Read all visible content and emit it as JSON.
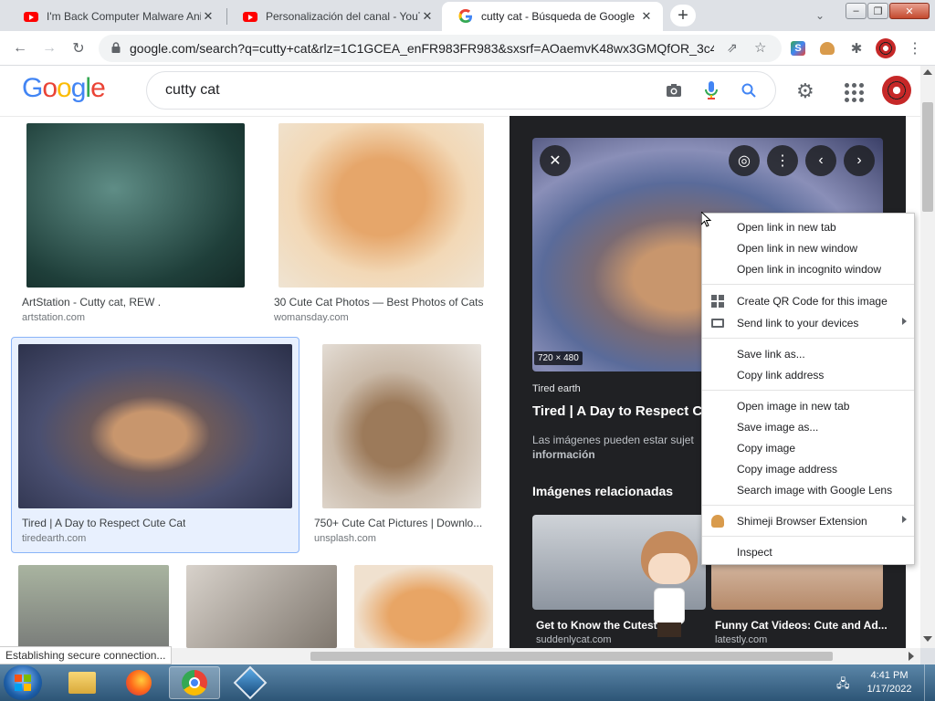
{
  "browser": {
    "tabs": [
      {
        "title": "I'm Back Computer Malware Anim",
        "favicon": "youtube-icon"
      },
      {
        "title": "Personalización del canal - YouTu",
        "favicon": "youtube-icon"
      },
      {
        "title": "cutty cat - Búsqueda de Google",
        "favicon": "google-icon",
        "active": true
      }
    ],
    "url": "google.com/search?q=cutty+cat&rlz=1C1GCEA_enFR983FR983&sxsrf=AOaemvK48wx3GMQfOR_3c4..."
  },
  "google": {
    "logo": "Google",
    "query": "cutty cat"
  },
  "results": [
    {
      "title": "ArtStation - Cutty cat, REW .",
      "site": "artstation.com"
    },
    {
      "title": "30 Cute Cat Photos — Best Photos of Cats",
      "site": "womansday.com"
    },
    {
      "title": "Tired | A Day to Respect Cute Cat",
      "site": "tiredearth.com"
    },
    {
      "title": "750+ Cute Cat Pictures | Downlo...",
      "site": "unsplash.com"
    }
  ],
  "panel": {
    "dimensions": "720 × 480",
    "source": "Tired earth",
    "title": "Tired | A Day to Respect Cut",
    "notice": "Las imágenes pueden estar sujet",
    "notice_link": "información",
    "related_heading": "Imágenes relacionadas",
    "related": [
      {
        "title": "Get to Know the Cutest C",
        "site": "suddenlycat.com"
      },
      {
        "title": "Funny Cat Videos: Cute and Ad...",
        "site": "latestly.com"
      }
    ]
  },
  "context_menu": {
    "items": [
      "Open link in new tab",
      "Open link in new window",
      "Open link in incognito window",
      "Create QR Code for this image",
      "Send link to your devices",
      "Save link as...",
      "Copy link address",
      "Open image in new tab",
      "Save image as...",
      "Copy image",
      "Copy image address",
      "Search image with Google Lens",
      "Shimeji Browser Extension",
      "Inspect"
    ]
  },
  "status": "Establishing secure connection...",
  "clock": {
    "time": "4:41 PM",
    "date": "1/17/2022"
  },
  "colors": {
    "accent": "#1a73e8",
    "panel_bg": "#202124",
    "youtube_red": "#ff0000"
  }
}
